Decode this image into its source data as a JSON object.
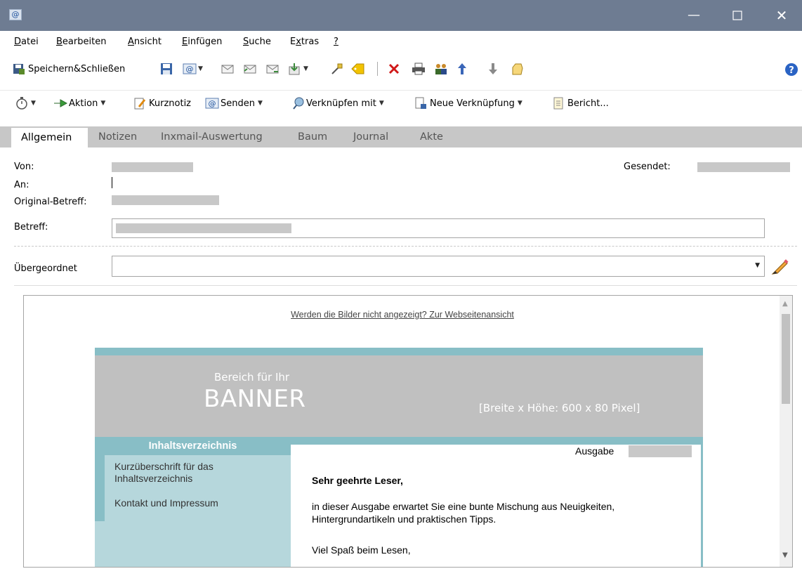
{
  "menu": [
    "Datei",
    "Bearbeiten",
    "Ansicht",
    "Einfügen",
    "Suche",
    "Extras",
    "?"
  ],
  "toolbar1": {
    "save_close": "Speichern&Schließen"
  },
  "toolbar2": {
    "aktion": "Aktion",
    "kurznotiz": "Kurznotiz",
    "senden": "Senden",
    "verknuepfen": "Verknüpfen mit",
    "neue_verknuepfung": "Neue Verknüpfung",
    "bericht": "Bericht..."
  },
  "tabs": [
    "Allgemein",
    "Notizen",
    "Inxmail-Auswertung",
    "Baum",
    "Journal",
    "Akte"
  ],
  "fields": {
    "von": "Von:",
    "an": "An:",
    "original_betreff": "Original-Betreff:",
    "betreff": "Betreff:",
    "gesendet": "Gesendet:",
    "uebergeordnet": "Übergeordnet"
  },
  "newsletter": {
    "web_link": "Werden die Bilder nicht angezeigt? Zur Webseitenansicht",
    "banner_small": "Bereich für Ihr",
    "banner_big": "BANNER",
    "banner_dim": "[Breite x Höhe: 600 x 80 Pixel]",
    "toc_title": "Inhaltsverzeichnis",
    "toc_items": [
      "Kurzüberschrift für das Inhaltsverzeichnis",
      "Kontakt und Impressum"
    ],
    "ausgabe": "Ausgabe",
    "greeting": "Sehr geehrte Leser,",
    "para1": "in dieser Ausgabe erwartet Sie eine bunte Mischung aus Neuigkeiten, Hintergrundartikeln und praktischen Tipps.",
    "para2": "Viel Spaß beim Lesen,"
  },
  "colors": {
    "titlebar": "#6e7c92",
    "tabbar": "#c7c7c7",
    "accent": "#88bec6",
    "toc_bg": "#b6d7dc",
    "banner": "#c0c0c0",
    "redaction": "#c8c8c8"
  }
}
